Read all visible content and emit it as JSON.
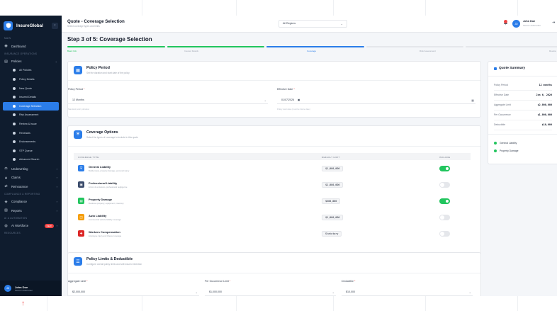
{
  "app": {
    "name": "InsureGlobal",
    "collapse_symbol": "‹"
  },
  "sidebar": {
    "sections": {
      "main": "MAIN",
      "insurance": "INSURANCE OPERATIONS",
      "compliance": "COMPLIANCE & REPORTING",
      "ai": "AI & AUTOMATION",
      "resources": "RESOURCES"
    },
    "dashboard": "Dashboard",
    "policies": "Policies",
    "policy_subitems": [
      "All Policies",
      "Policy Details",
      "New Quote",
      "Insured Details",
      "Coverage Selection",
      "Risk Assessment",
      "Review & Issue",
      "Renewals",
      "Endorsements",
      "STP Queue",
      "Advanced Search"
    ],
    "underwriting": "Underwriting",
    "claims": "Claims",
    "reinsurance": "Reinsurance",
    "compliance": "Compliance",
    "reports": "Reports",
    "ai_workforce": "AI Workforce",
    "ai_badge": "NEW",
    "user": {
      "initials": "JD",
      "name": "John Doe",
      "role": "Senior Underwriter"
    }
  },
  "header": {
    "title": "Quote - Coverage Selection",
    "subtitle": "Select coverage types and limits",
    "region": "All Regions",
    "user": {
      "initials": "JD",
      "name": "John Doe",
      "role": "Senior Underwriter"
    }
  },
  "wizard": {
    "step_title": "Step 3 of 5: Coverage Selection",
    "progress": {
      "completed": 2,
      "current": 3,
      "total": 5
    },
    "steps": [
      "Basic Info",
      "Insured Details",
      "Coverage",
      "Risk Assessment",
      "Review"
    ]
  },
  "policy_period": {
    "title": "Policy Period",
    "desc": "Set the duration and start date of the policy",
    "period_label": "Policy Period",
    "period_value": "12 Months",
    "period_help": "Standard policy duration",
    "date_label": "Effective Date",
    "date_value": "01/07/2026",
    "date_help": "Policy start date (must be future date)"
  },
  "coverage": {
    "title": "Coverage Options",
    "desc": "Select the types of coverage to include in this quote",
    "col_type": "COVERAGE TYPE",
    "col_limit": "DEFAULT LIMIT",
    "col_include": "INCLUDE",
    "rows": [
      {
        "name": "General Liability",
        "desc": "Bodily injury, property damage, personal injury",
        "limit": "$1,000,000",
        "included": true,
        "color": "#2b7de9",
        "icon": "shield-icon"
      },
      {
        "name": "Professional Liability",
        "desc": "Errors & omissions, professional negligence",
        "limit": "$1,000,000",
        "included": false,
        "color": "#3b4b6b",
        "icon": "briefcase-icon"
      },
      {
        "name": "Property Damage",
        "desc": "Business property, equipment, inventory",
        "limit": "$500,000",
        "included": true,
        "color": "#22c55e",
        "icon": "building-icon"
      },
      {
        "name": "Auto Liability",
        "desc": "Commercial vehicle liability coverage",
        "limit": "$1,000,000",
        "included": false,
        "color": "#f59e0b",
        "icon": "car-icon"
      },
      {
        "name": "Workers Compensation",
        "desc": "Employee injury and illness coverage",
        "limit": "Statutory",
        "included": false,
        "color": "#dc2626",
        "icon": "medical-icon"
      }
    ]
  },
  "limits": {
    "title": "Policy Limits & Deductible",
    "desc": "Configure overall policy limits and self-insured retention",
    "aggregate_label": "Aggregate Limit",
    "aggregate_value": "$2,000,000",
    "occurrence_label": "Per Occurrence Limit",
    "occurrence_value": "$1,000,000",
    "deductible_label": "Deductible",
    "deductible_value": "$10,000"
  },
  "summary": {
    "title": "Quote Summary",
    "rows": [
      {
        "k": "Policy Period",
        "v": "12 months"
      },
      {
        "k": "Effective Date",
        "v": "Jan 6, 2026"
      },
      {
        "k": "Aggregate Limit",
        "v": "$2,000,000"
      },
      {
        "k": "Per Occurrence",
        "v": "$1,000,000"
      },
      {
        "k": "Deductible",
        "v": "$10,000"
      }
    ],
    "coverages": [
      "General Liability",
      "Property Damage"
    ]
  },
  "colors": {
    "accent": "#2b7de9",
    "success": "#22c55e",
    "sidebar": "#0f1c2e",
    "danger": "#ef4444"
  },
  "annotation": {
    "arrow": "↑"
  }
}
